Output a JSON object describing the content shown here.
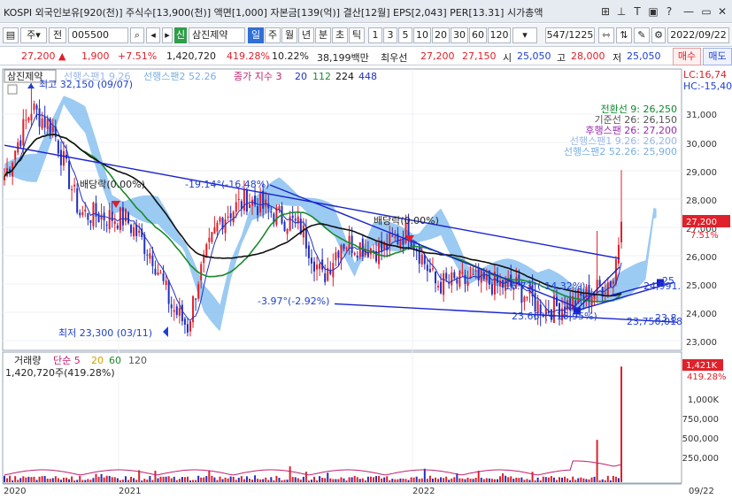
{
  "title_bar": {
    "title": "KOSPI 외국인보유[920(천)] 주식수[13,900(천)] 액면[1,000] 자본금[139(억)] 결산[12월] EPS[2,043] PER[13.31] 시가총액",
    "icons": [
      "grid-icon",
      "pin-icon",
      "link-icon",
      "tile-icon",
      "help-icon",
      "minimize-icon",
      "restore-icon",
      "close-icon"
    ],
    "symbols": [
      "⊞",
      "⊥",
      "T",
      "▣",
      "?",
      "—",
      "▭",
      "✕"
    ]
  },
  "toolbar": {
    "type_select": "주",
    "type_select_arrow": "▾",
    "market_label": "전",
    "code_value": "005500",
    "stock_name": "삼진제약",
    "periods": [
      "일",
      "주",
      "월",
      "년",
      "분",
      "초",
      "틱"
    ],
    "intervals": [
      "1",
      "3",
      "5",
      "10",
      "20",
      "30",
      "60",
      "120"
    ],
    "count": "547/1225",
    "date": "2022/09/22"
  },
  "info_bar": {
    "price": "27,200",
    "up_arrow": "▲",
    "change": "1,900",
    "change_pct": "+7.51%",
    "volume": "1,420,720",
    "volume_ratio": "419.28%",
    "turnover": "10.22%",
    "amount": "38,199백만",
    "prev_label": "최우선",
    "best_ask": "27,200",
    "best_bid": "27,150",
    "open_label": "시",
    "open": "25,050",
    "high_label": "고",
    "high": "28,000",
    "low_label": "저",
    "low": "25,050",
    "buy_label": "매수",
    "sell_label": "매도"
  },
  "chart": {
    "stock_tag": "삼진제약",
    "legend": {
      "span1": "선행스팬1 9.26",
      "span2": "선행스팬2 52.26",
      "ma_title": "종가 지수 3",
      "ma_20": "20",
      "ma_112": "112",
      "ma_224": "224",
      "ma_448": "448"
    },
    "right_top": [
      "LC:16,74",
      "HC:-15,40"
    ],
    "ichimoku": [
      {
        "text": "전환선 9: 26,250",
        "color": "#0a8a2a"
      },
      {
        "text": "기준선 26: 26,150",
        "color": "#555555"
      },
      {
        "text": "후행스팬 26: 27,200",
        "color": "#9a2ab0"
      },
      {
        "text": "선행스팬1 9.26: 26,200",
        "color": "#9ab8e6"
      },
      {
        "text": "선행스팬2 52.26: 25,900",
        "color": "#7aaee0"
      }
    ],
    "annotations": {
      "high": "최고 32,150 (09/07)",
      "low": "최저 23,300 (03/11)",
      "dividend1": "배당락(0.00%)",
      "dividend2": "배당락(0.00%)",
      "pct1": "-19.14°(-16.48%)",
      "pct2": "-3.97°(-2.92%)",
      "pct3": "-16.73°(-14.32%)",
      "pct4": "23.66°(+16.95%)",
      "low2": "23,750,018",
      "right_mid": "24,991.",
      "p25": "25",
      "p23_8": "23.8"
    },
    "price_ticks": [
      "31,000",
      "30,000",
      "29,000",
      "28,000",
      "27,000",
      "26,000",
      "25,000",
      "24,000",
      "23,000"
    ],
    "price_tag": "27,200",
    "price_tag_pct": "7.51%",
    "volume_legend": {
      "title": "거래량",
      "sma5": "단순 5",
      "sma20": "20",
      "sma60": "60",
      "sma120": "120",
      "value": "1,420,720주(419.28%)"
    },
    "volume_ticks": [
      "1,000K",
      "750,000",
      "500,000",
      "250,000"
    ],
    "volume_tag": "1,421K",
    "volume_tag_pct": "419.28%",
    "x_labels": [
      "2020",
      "2021",
      "2022",
      "09/22"
    ],
    "colors": {
      "candle_up": "#e0202a",
      "candle_down": "#2030c0",
      "ma_black": "#111111",
      "ma_green": "#1a8a2a",
      "trend_blue": "#1a22d0",
      "cloud": "#7ab8ee"
    }
  }
}
